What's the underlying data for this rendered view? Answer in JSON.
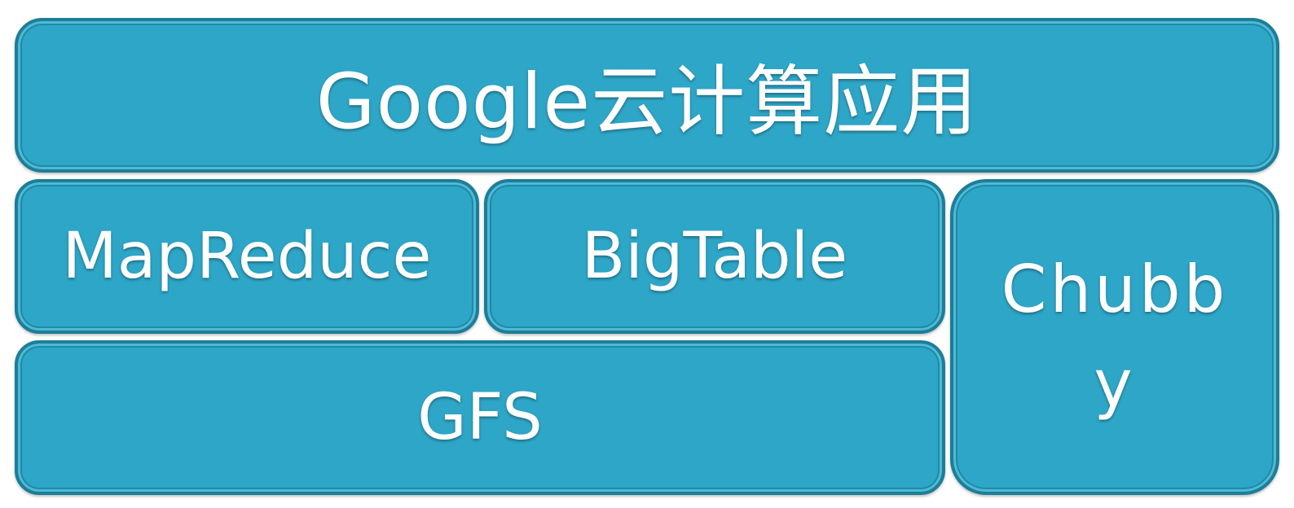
{
  "diagram": {
    "top_label": "Google云计算应用",
    "mapreduce_label": "MapReduce",
    "bigtable_label": "BigTable",
    "gfs_label": "GFS",
    "chubby_label": "Chubby"
  },
  "colors": {
    "block_fill": "#2ea6c7",
    "block_border": "#1c7e98",
    "text": "#ffffff"
  }
}
